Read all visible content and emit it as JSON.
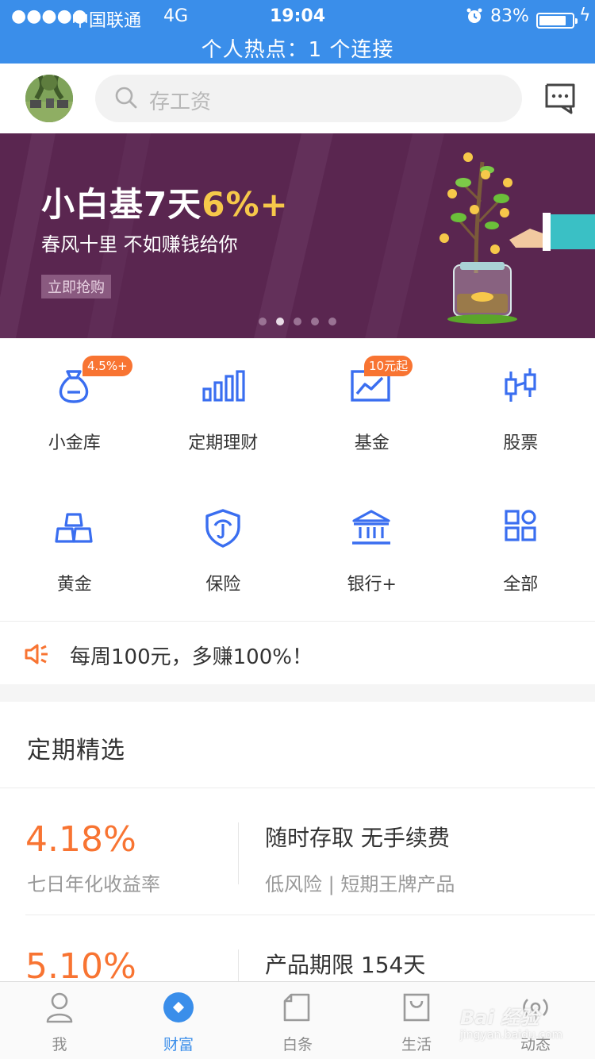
{
  "status_bar": {
    "signal": "●●●●●",
    "carrier": "中国联通",
    "network": "4G",
    "time": "19:04",
    "battery_pct": "83%",
    "battery_level": 0.83,
    "hotspot": "个人热点：1 个连接"
  },
  "header": {
    "search_placeholder": "存工资"
  },
  "banner": {
    "title_main": "小白基7天",
    "title_highlight": "6%+",
    "subtitle": "春风十里 不如赚钱给你",
    "cta": "立即抢购",
    "page_count": 5,
    "active_page": 2,
    "colors": {
      "background": "#5a2650",
      "highlight": "#f6c84a"
    }
  },
  "grid": [
    {
      "label": "小金库",
      "icon": "money-bag-icon",
      "badge": "4.5%+"
    },
    {
      "label": "定期理财",
      "icon": "bar-chart-icon",
      "badge": ""
    },
    {
      "label": "基金",
      "icon": "trend-chart-icon",
      "badge": "10元起"
    },
    {
      "label": "股票",
      "icon": "candlestick-icon",
      "badge": ""
    },
    {
      "label": "黄金",
      "icon": "gold-bars-icon",
      "badge": ""
    },
    {
      "label": "保险",
      "icon": "shield-icon",
      "badge": ""
    },
    {
      "label": "银行+",
      "icon": "bank-icon",
      "badge": ""
    },
    {
      "label": "全部",
      "icon": "apps-grid-icon",
      "badge": ""
    }
  ],
  "notice": {
    "icon": "speaker-icon",
    "text": "每周100元，多赚100%！"
  },
  "section": {
    "title": "定期精选",
    "products": [
      {
        "rate": "4.18%",
        "rate_label": "七日年化收益率",
        "title": "随时存取 无手续费",
        "desc": "低风险 | 短期王牌产品"
      },
      {
        "rate": "5.10%",
        "rate_label": "",
        "title": "产品期限 154天",
        "desc": ""
      }
    ]
  },
  "tabbar": {
    "tabs": [
      {
        "label": "我",
        "icon": "person-icon",
        "active": false
      },
      {
        "label": "财富",
        "icon": "wealth-icon",
        "active": true
      },
      {
        "label": "白条",
        "icon": "card-icon",
        "active": false
      },
      {
        "label": "生活",
        "icon": "shopping-bag-icon",
        "active": false
      },
      {
        "label": "动态",
        "icon": "broadcast-icon",
        "active": false
      }
    ]
  },
  "colors": {
    "primary": "#3a8eea",
    "accent": "#f87432"
  },
  "watermark": {
    "brand": "Bai 经验",
    "url": "jingyan.baidu.com"
  }
}
